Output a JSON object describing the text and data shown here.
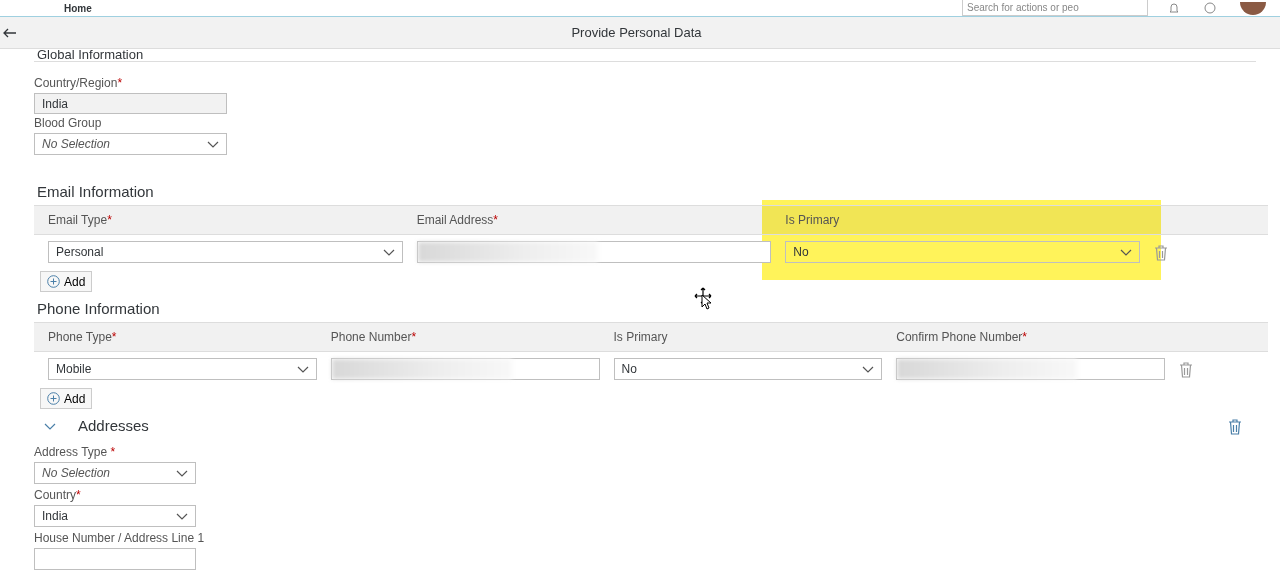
{
  "shell": {
    "home": "Home",
    "search_placeholder": "Search for actions or peo"
  },
  "page_title": "Provide Personal Data",
  "global": {
    "title": "Global Information",
    "fields": [
      {
        "label": "Country/Region",
        "required_mark": "*",
        "kind": "readonly",
        "value": "India",
        "empty": false
      },
      {
        "label": "Blood Group",
        "kind": "select",
        "value": "No Selection",
        "empty": true
      }
    ]
  },
  "email": {
    "title": "Email Information",
    "columns": [
      {
        "label": "Email Type",
        "required_mark": "*",
        "highlighted": false
      },
      {
        "label": "Email Address",
        "required_mark": "*",
        "highlighted": false
      },
      {
        "label": "Is Primary",
        "highlighted": true
      }
    ],
    "rows": [
      {
        "cells": [
          {
            "kind": "select",
            "value": "Personal"
          },
          {
            "kind": "redacted"
          },
          {
            "kind": "select",
            "value": "No"
          }
        ]
      }
    ],
    "add_button": "Add"
  },
  "phone": {
    "title": "Phone Information",
    "columns": [
      {
        "label": "Phone Type",
        "required_mark": "*",
        "highlighted": false
      },
      {
        "label": "Phone Number",
        "required_mark": "*",
        "highlighted": false
      },
      {
        "label": "Is Primary",
        "highlighted": false
      },
      {
        "label": "Confirm Phone Number",
        "required_mark": "*",
        "highlighted": false
      }
    ],
    "rows": [
      {
        "cells": [
          {
            "kind": "select",
            "value": "Mobile"
          },
          {
            "kind": "redacted"
          },
          {
            "kind": "select",
            "value": "No"
          },
          {
            "kind": "redacted"
          }
        ]
      }
    ],
    "add_button": "Add"
  },
  "addresses": {
    "title": "Addresses",
    "expanded": true,
    "fields": [
      {
        "label": "Address Type ",
        "required_mark": "*",
        "kind": "select",
        "value": "No Selection",
        "empty": true
      },
      {
        "label": "Country",
        "required_mark": "*",
        "kind": "select",
        "value": "India",
        "empty": false
      },
      {
        "label": "House Number / Address Line 1",
        "kind": "text"
      }
    ]
  }
}
